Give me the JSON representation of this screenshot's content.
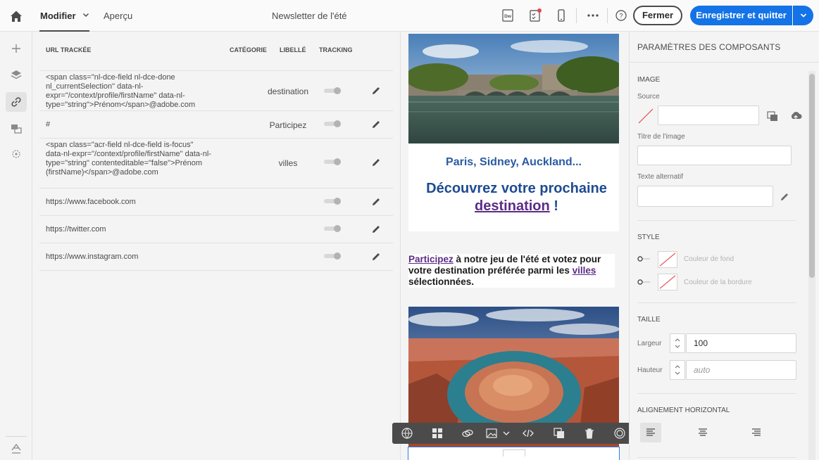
{
  "header": {
    "tabs": [
      {
        "label": "Modifier",
        "active": true
      },
      {
        "label": "Aperçu",
        "active": false
      }
    ],
    "title": "Newsletter de l'été",
    "close_label": "Fermer",
    "save_label": "Enregistrer et quitter",
    "accent_color": "#1473e6"
  },
  "rail": {
    "items": [
      "add-icon",
      "layers-icon",
      "link-icon",
      "content-fragments-icon",
      "personalization-icon"
    ],
    "bottom_item": "sign-icon"
  },
  "links_table": {
    "columns": [
      "URL TRACKÉE",
      "CATÉGORIE",
      "LIBELLÉ",
      "TRACKING"
    ],
    "rows": [
      {
        "url": "<span class=\"nl-dce-field nl-dce-done nl_currentSelection\" data-nl-expr=\"/context/profile/firstName\" data-nl-type=\"string\">Prénom</span>@adobe.com",
        "label": "destination"
      },
      {
        "url": "#",
        "label": "Participez"
      },
      {
        "url": "<span class=\"acr-field nl-dce-field is-focus\" data-nl-expr=\"/context/profile/firstName\" data-nl-type=\"string\" contenteditable=\"false\">Prénom (firstName)</span>@adobe.com",
        "label": "villes"
      },
      {
        "url": "https://www.facebook.com",
        "label": ""
      },
      {
        "url": "https://twitter.com",
        "label": ""
      },
      {
        "url": "https://www.instagram.com",
        "label": ""
      }
    ]
  },
  "preview": {
    "subtitle": "Paris, Sidney, Auckland...",
    "heading_pre": "Découvrez votre prochaine",
    "heading_link": "destination",
    "heading_post": " !",
    "para_link1": "Participez",
    "para_mid": " à notre jeu de l'été et votez pour votre destination préférée parmi les ",
    "para_link2": "villes",
    "para_end": " sélectionnées."
  },
  "properties": {
    "title": "PARAMÈTRES DES COMPOSANTS",
    "image_section": "IMAGE",
    "source_label": "Source",
    "title_label": "Titre de l'image",
    "alt_label": "Texte alternatif",
    "style_section": "STYLE",
    "bg_color_label": "Couleur de fond",
    "border_color_label": "Couleur de la bordure",
    "size_section": "TAILLE",
    "width_label": "Largeur",
    "width_value": "100",
    "height_label": "Hauteur",
    "height_placeholder": "auto",
    "align_section": "ALIGNEMENT HORIZONTAL"
  }
}
